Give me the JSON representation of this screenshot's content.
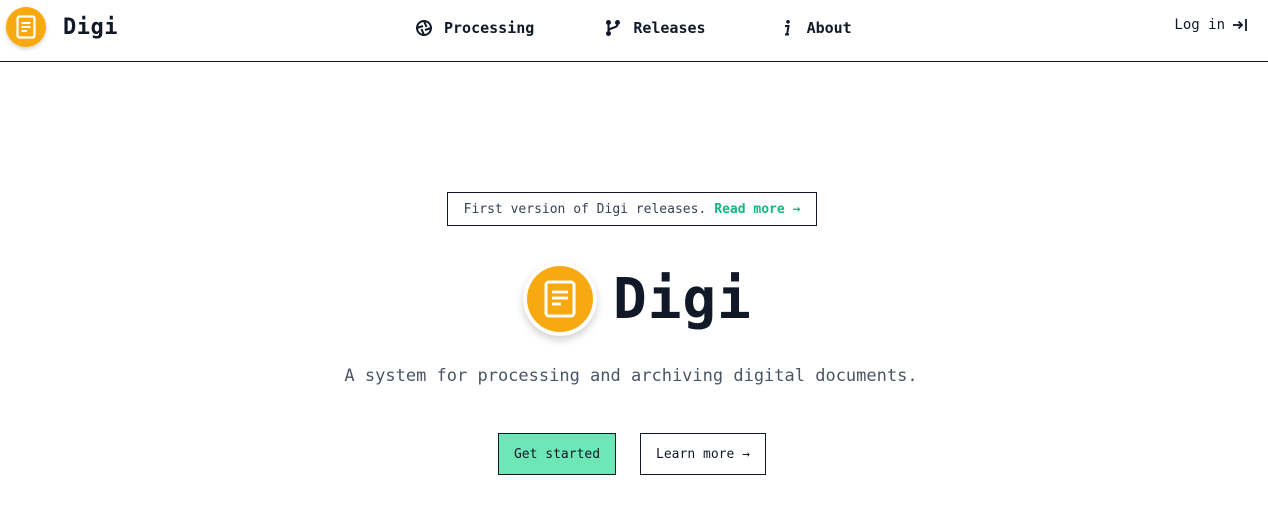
{
  "header": {
    "brand_name": "Digi",
    "nav": [
      {
        "label": "Processing",
        "icon": "aperture-icon"
      },
      {
        "label": "Releases",
        "icon": "git-branch-icon"
      },
      {
        "label": "About",
        "icon": "info-icon"
      }
    ],
    "login_label": "Log in",
    "login_icon": "login-arrow-icon"
  },
  "hero": {
    "announcement_text": "First version of Digi releases.",
    "announcement_link": "Read more →",
    "title": "Digi",
    "tagline": "A system for processing and archiving digital documents.",
    "primary_button": "Get started",
    "secondary_button": "Learn more →"
  },
  "colors": {
    "brand_orange": "#f7a90f",
    "accent_green": "#10b981",
    "primary_button_bg": "#6ee7b7",
    "text_dark": "#111827"
  }
}
